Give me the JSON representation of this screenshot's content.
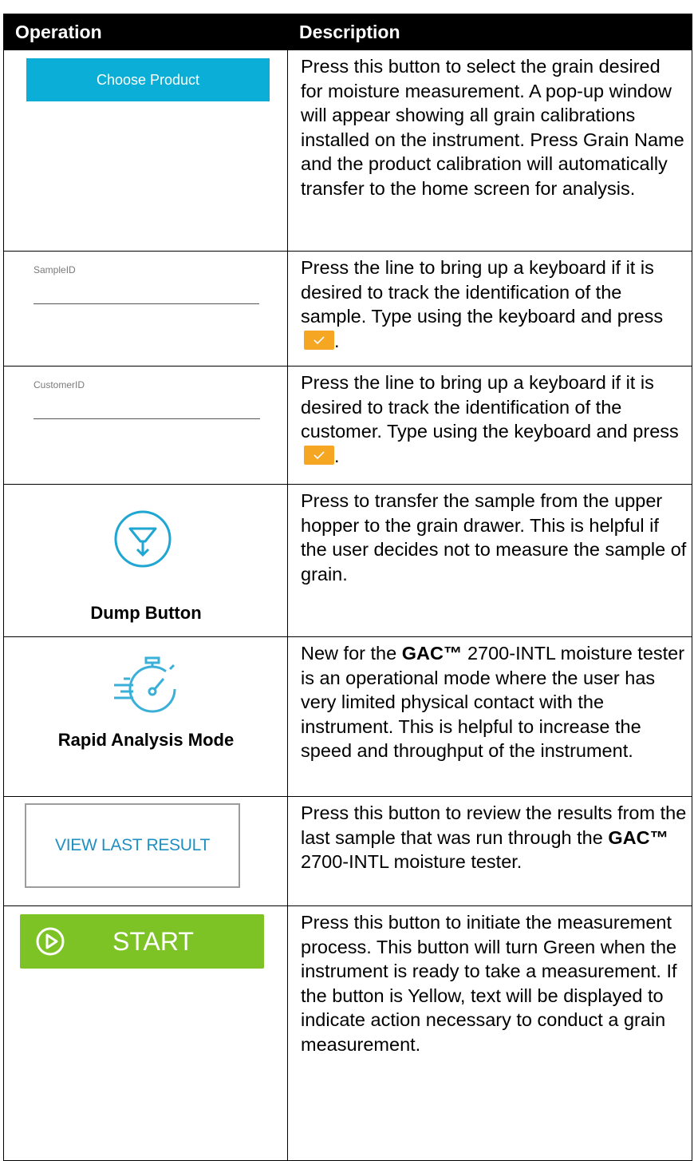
{
  "header": {
    "operation": "Operation",
    "description": "Description"
  },
  "rows": {
    "choose_product": {
      "button_label": "Choose Product",
      "description": "Press this button to select the grain desired for moisture measurement. A pop-up window will appear showing all grain calibrations installed on the instrument. Press Grain Name and the product calibration will automatically transfer to the home screen for analysis.",
      "button_color": "#0aaed6"
    },
    "sample_id": {
      "field_label": "SampleID",
      "description_before": "Press the line to bring up a keyboard if it is desired to track the identification of the sample. Type using the keyboard and press",
      "description_after": "."
    },
    "customer_id": {
      "field_label": "CustomerID",
      "description_before": "Press the line to bring up a keyboard if it is desired to track the identification of the customer. Type using the keyboard and press",
      "description_after": "."
    },
    "dump": {
      "icon": "dump-funnel-icon",
      "caption": "Dump Button",
      "description": "Press to transfer the sample from the upper hopper to the grain drawer. This is helpful if the user decides not to measure the sample of grain."
    },
    "rapid": {
      "icon": "stopwatch-icon",
      "caption": "Rapid Analysis Mode",
      "desc_lead": "New for the",
      "brand": "GAC™",
      "desc_rest": "2700-INTL moisture tester is an operational mode where the user has very limited physical contact with the instrument. This is helpful to increase the speed and throughput of the instrument."
    },
    "view_last": {
      "button_label": "VIEW LAST RESULT",
      "desc_lead": "Press this button to review the results from the last sample that was run through the",
      "brand": "GAC™",
      "desc_rest": "2700-INTL moisture tester."
    },
    "start": {
      "button_label": "START",
      "icon": "play-circle-icon",
      "button_color": "#7ec325",
      "description": "Press this button to initiate the measurement process. This button will turn Green when the instrument is ready to take a measurement. If the button is Yellow, text will be displayed to indicate action necessary to conduct a grain measurement."
    }
  },
  "colors": {
    "header_bg": "#000000",
    "check_bg": "#f5a623",
    "view_text": "#1f8fc2",
    "dump_icon": "#1fa6d2"
  }
}
